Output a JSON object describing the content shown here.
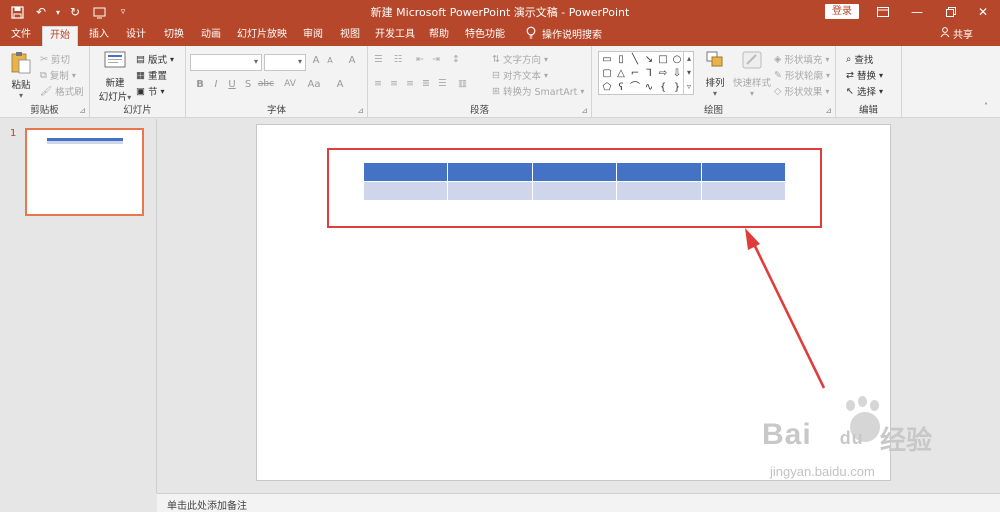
{
  "window": {
    "title": "新建 Microsoft PowerPoint 演示文稿 - PowerPoint",
    "login_label": "登录"
  },
  "quick_access": [
    "save-icon",
    "undo-icon",
    "redo-icon",
    "touch-mode-icon",
    "customize-icon"
  ],
  "tabs": [
    {
      "label": "文件"
    },
    {
      "label": "开始",
      "active": true
    },
    {
      "label": "插入"
    },
    {
      "label": "设计"
    },
    {
      "label": "切换"
    },
    {
      "label": "动画"
    },
    {
      "label": "幻灯片放映"
    },
    {
      "label": "审阅"
    },
    {
      "label": "视图"
    },
    {
      "label": "开发工具"
    },
    {
      "label": "帮助"
    },
    {
      "label": "特色功能"
    }
  ],
  "tell_me": "操作说明搜索",
  "share": "共享",
  "ribbon": {
    "clipboard": {
      "label": "剪贴板",
      "paste": "粘贴",
      "cut": "剪切",
      "copy": "复制",
      "format_painter": "格式刷"
    },
    "slides": {
      "label": "幻灯片",
      "new_slide_1": "新建",
      "new_slide_2": "幻灯片",
      "layout": "版式",
      "reset": "重置",
      "section": "节"
    },
    "font": {
      "label": "字体",
      "bold": "B",
      "italic": "I",
      "underline": "U",
      "shadow": "S",
      "strike": "abc",
      "spacing": "AV",
      "case": "Aa",
      "grow": "A",
      "shrink": "A",
      "clear": "A",
      "color": "A"
    },
    "paragraph": {
      "label": "段落",
      "text_direction": "文字方向",
      "align_text": "对齐文本",
      "smartart": "转换为 SmartArt"
    },
    "drawing": {
      "label": "绘图",
      "arrange": "排列",
      "quick_styles": "快速样式",
      "shape_fill": "形状填充",
      "shape_outline": "形状轮廓",
      "shape_effects": "形状效果"
    },
    "editing": {
      "label": "编辑",
      "find": "查找",
      "replace": "替换",
      "select": "选择"
    }
  },
  "thumbnails": [
    {
      "number": "1"
    }
  ],
  "slide_table": {
    "columns": 5,
    "header_color": "#4472c4",
    "band_color": "#cfd5ea",
    "rows": [
      [
        "",
        "",
        "",
        "",
        ""
      ],
      [
        "",
        "",
        "",
        "",
        ""
      ]
    ]
  },
  "notes_placeholder": "单击此处添加备注",
  "colors": {
    "accent": "#b7472a",
    "highlight_frame": "#e03c3c",
    "thumb_border": "#e8774d"
  },
  "watermark": {
    "brand": "Bai",
    "brand2": "du",
    "cn": "经验",
    "url": "jingyan.baidu.com"
  }
}
